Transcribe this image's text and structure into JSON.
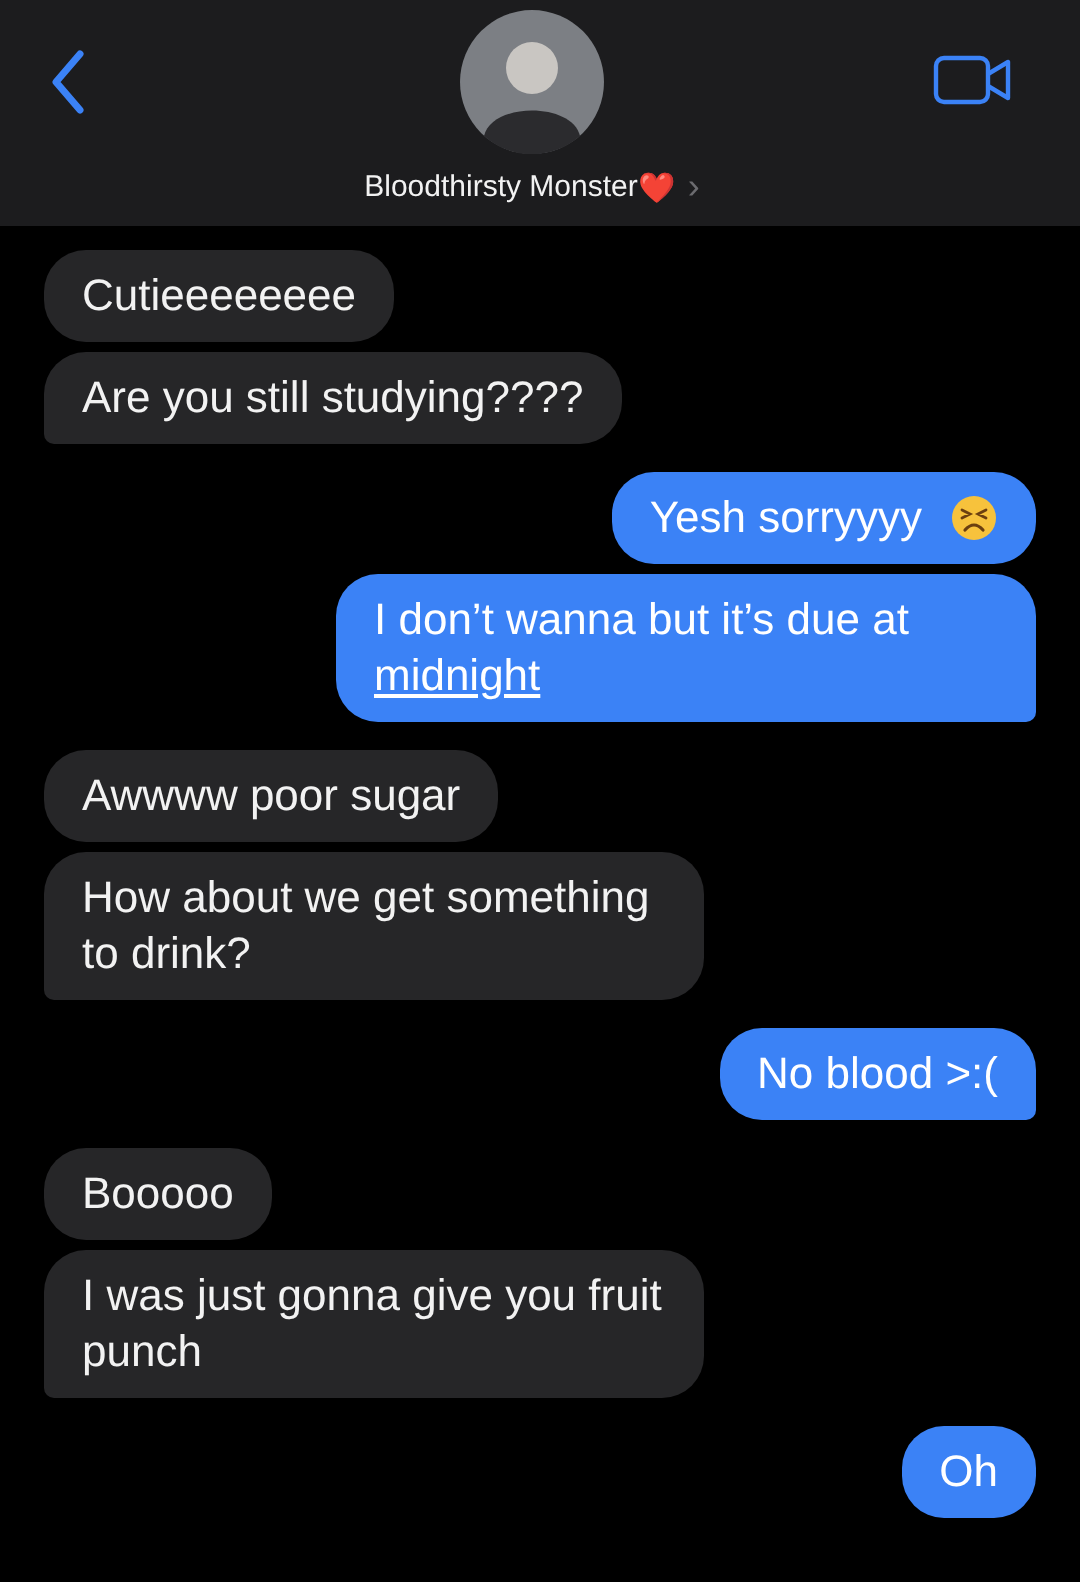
{
  "header": {
    "contact_name": "Bloodthirsty Monster",
    "name_badge": "❤️",
    "chevron": "›"
  },
  "messages": [
    {
      "kind": "incoming",
      "text": "Cutieeeeeeee",
      "tail": false
    },
    {
      "kind": "incoming",
      "text": "Are you still studying????",
      "tail": true
    },
    {
      "kind": "outgoing",
      "text": "Yesh sorryyyy",
      "emoji": true,
      "tail": false
    },
    {
      "kind": "outgoing",
      "text": "I don’t wanna but it’s due at",
      "link": "midnight",
      "tail": true
    },
    {
      "kind": "incoming",
      "text": "Awwww poor sugar",
      "tail": false
    },
    {
      "kind": "incoming",
      "text": "How about we get something to drink?",
      "tail": true
    },
    {
      "kind": "outgoing",
      "text": "No blood >:(",
      "tail": true
    },
    {
      "kind": "incoming",
      "text": "Booooo",
      "tail": false
    },
    {
      "kind": "incoming",
      "text": "I was just gonna give you fruit punch",
      "tail": true
    },
    {
      "kind": "outgoing",
      "text": "Oh",
      "tail": false
    }
  ]
}
